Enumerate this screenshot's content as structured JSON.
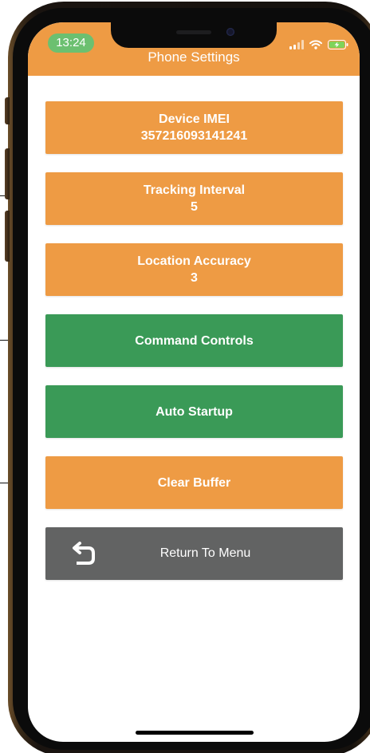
{
  "status_bar": {
    "time": "13:24",
    "icons": [
      "signal-icon",
      "wifi-icon",
      "battery-charging-icon"
    ]
  },
  "header": {
    "title": "Phone Settings",
    "color": "#ee9b44"
  },
  "buttons": [
    {
      "name": "device-imei-button",
      "line1": "Device IMEI",
      "line2": "357216093141241",
      "color": "#ee9b44"
    },
    {
      "name": "tracking-interval-button",
      "line1": "Tracking Interval",
      "line2": "5",
      "color": "#ee9b44"
    },
    {
      "name": "location-accuracy-button",
      "line1": "Location Accuracy",
      "line2": "3",
      "color": "#ee9b44"
    },
    {
      "name": "command-controls-button",
      "line1": "Command Controls",
      "color": "#3a9a57"
    },
    {
      "name": "auto-startup-button",
      "line1": "Auto Startup",
      "color": "#3a9a57"
    },
    {
      "name": "clear-buffer-button",
      "line1": "Clear Buffer",
      "color": "#ee9b44"
    },
    {
      "name": "return-to-menu-button",
      "line1": "Return To Menu",
      "icon": "return-arrow-icon",
      "color": "#626363"
    }
  ],
  "colors": {
    "accent_orange": "#ee9b44",
    "accent_green": "#3a9a57",
    "neutral_gray": "#626363",
    "time_pill_green": "#6cc070"
  }
}
